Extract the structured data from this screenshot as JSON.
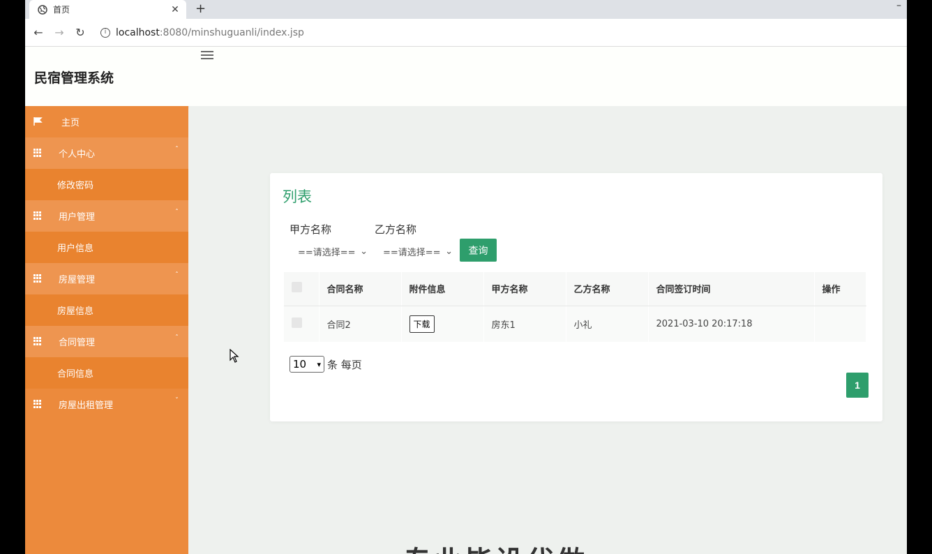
{
  "browser": {
    "tab_title": "首页",
    "tab_close": "✕",
    "new_tab": "+",
    "url_host": "localhost",
    "url_path": ":8080/minshuguanli/index.jsp"
  },
  "header": {
    "app_title": "民宿管理系统"
  },
  "sidebar": {
    "items": [
      {
        "label": "主页",
        "type": "home"
      },
      {
        "label": "个人中心",
        "type": "group"
      },
      {
        "label": "修改密码",
        "type": "sub"
      },
      {
        "label": "用户管理",
        "type": "group"
      },
      {
        "label": "用户信息",
        "type": "sub"
      },
      {
        "label": "房屋管理",
        "type": "group"
      },
      {
        "label": "房屋信息",
        "type": "sub"
      },
      {
        "label": "合同管理",
        "type": "group"
      },
      {
        "label": "合同信息",
        "type": "sub"
      },
      {
        "label": "房屋出租管理",
        "type": "group"
      }
    ]
  },
  "card": {
    "title": "列表",
    "filter_a_label": "甲方名称",
    "filter_a_value": "==请选择==",
    "filter_b_label": "乙方名称",
    "filter_b_value": "==请选择==",
    "query_label": "查询"
  },
  "table": {
    "headers": [
      "合同名称",
      "附件信息",
      "甲方名称",
      "乙方名称",
      "合同签订时间",
      "操作"
    ],
    "rows": [
      {
        "name": "合同2",
        "attachment": "下载",
        "party_a": "房东1",
        "party_b": "小礼",
        "signed": "2021-03-10 20:17:18",
        "ops": ""
      }
    ]
  },
  "pagination": {
    "page_size": "10",
    "page_size_suffix": "条 每页",
    "current_page": "1"
  },
  "banner": {
    "text": "专业毕设代做"
  },
  "colors": {
    "sidebar": "#ec8a3c",
    "accent": "#2e9e6c"
  }
}
